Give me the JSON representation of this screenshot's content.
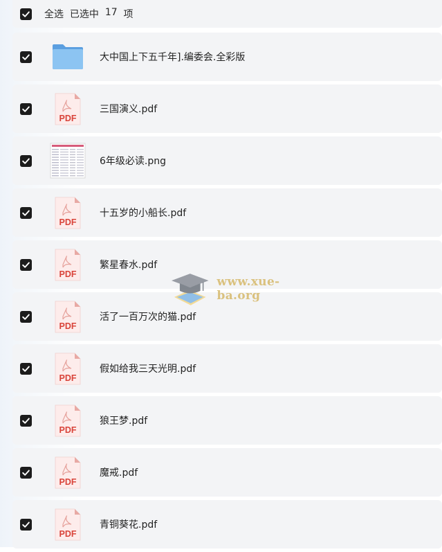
{
  "header": {
    "select_all": "全选",
    "selected_prefix": "已选中",
    "selected_count": "17",
    "selected_suffix": "项"
  },
  "files": [
    {
      "name": "大中国上下五千年].编委会.全彩版",
      "icon": "folder-icon"
    },
    {
      "name": "三国演义.pdf",
      "icon": "pdf-icon"
    },
    {
      "name": "6年级必读.png",
      "icon": "image-thumbnail"
    },
    {
      "name": "十五岁的小船长.pdf",
      "icon": "pdf-icon"
    },
    {
      "name": "繁星春水.pdf",
      "icon": "pdf-icon"
    },
    {
      "name": "活了一百万次的猫.pdf",
      "icon": "pdf-icon"
    },
    {
      "name": "假如给我三天光明.pdf",
      "icon": "pdf-icon"
    },
    {
      "name": "狼王梦.pdf",
      "icon": "pdf-icon"
    },
    {
      "name": "魔戒.pdf",
      "icon": "pdf-icon"
    },
    {
      "name": "青铜葵花.pdf",
      "icon": "pdf-icon"
    }
  ],
  "pdf_badge": "PDF",
  "watermark": {
    "text": "www.xue-ba.org"
  },
  "colors": {
    "checkbox": "#1c1c1c",
    "row_bg": "#f3f4f6",
    "pdf_red": "#d9443a",
    "folder_blue": "#5ba6e8"
  }
}
